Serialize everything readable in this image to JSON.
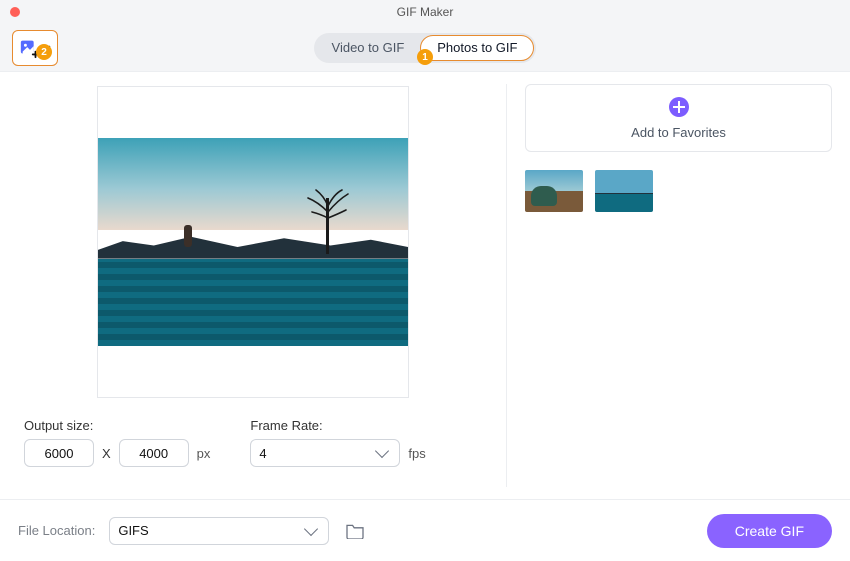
{
  "window": {
    "title": "GIF Maker"
  },
  "tabs": {
    "video_label": "Video to GIF",
    "photos_label": "Photos to GIF",
    "active": "photos"
  },
  "badges": {
    "add_media": "2",
    "photos_tab": "1"
  },
  "output": {
    "size_label": "Output size:",
    "width": "6000",
    "height": "4000",
    "unit": "px",
    "sep": "X",
    "framerate_label": "Frame Rate:",
    "framerate": "4",
    "framerate_unit": "fps"
  },
  "favorites": {
    "add_label": "Add to Favorites"
  },
  "thumbnails": [
    {
      "name": "classic-car"
    },
    {
      "name": "pool-tree"
    }
  ],
  "file_location": {
    "label": "File Location:",
    "value": "GIFS"
  },
  "actions": {
    "create_gif": "Create GIF"
  }
}
